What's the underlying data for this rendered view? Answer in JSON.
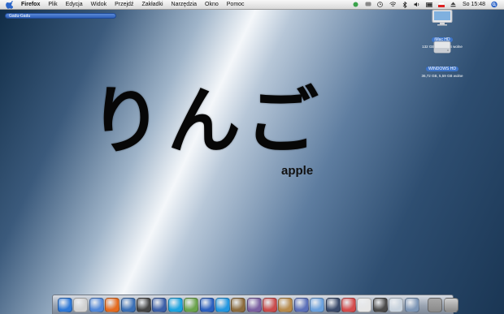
{
  "menubar": {
    "items": [
      "Firefox",
      "Plik",
      "Edycja",
      "Widok",
      "Przejdź",
      "Zakładki",
      "Narzędzia",
      "Okno",
      "Pomoc"
    ],
    "clock": "So 15:48"
  },
  "tab_pill": "Gadu-Gadu",
  "desktop": {
    "japanese": "りんご",
    "english": "apple",
    "drives": [
      {
        "label": "iMac HD",
        "info": "132 GB, 67,19 GB wolne"
      },
      {
        "label": "WINDOWS HD",
        "info": "36,72 GB, 5,59 GB wolne"
      }
    ]
  },
  "colors": {
    "dock_icon_colors": [
      "#2c77d6",
      "#d0d0d0",
      "#4f86d8",
      "#e46a1d",
      "#3a6fb5",
      "#444444",
      "#3b5fa8",
      "#1aa3e0",
      "#6aa24b",
      "#2a5fbf",
      "#2196e0",
      "#8c6b3d",
      "#7a5fa0",
      "#c94b4b",
      "#b78a4a",
      "#5a6fb8",
      "#6aa0dd",
      "#3a4a6a",
      "#d44b4b",
      "#e6e6e6",
      "#4a4a4a",
      "#c7d2dd",
      "#7d96b6"
    ],
    "dock_right_colors": [
      "#a7a7a7",
      "#cfcfcf"
    ]
  }
}
